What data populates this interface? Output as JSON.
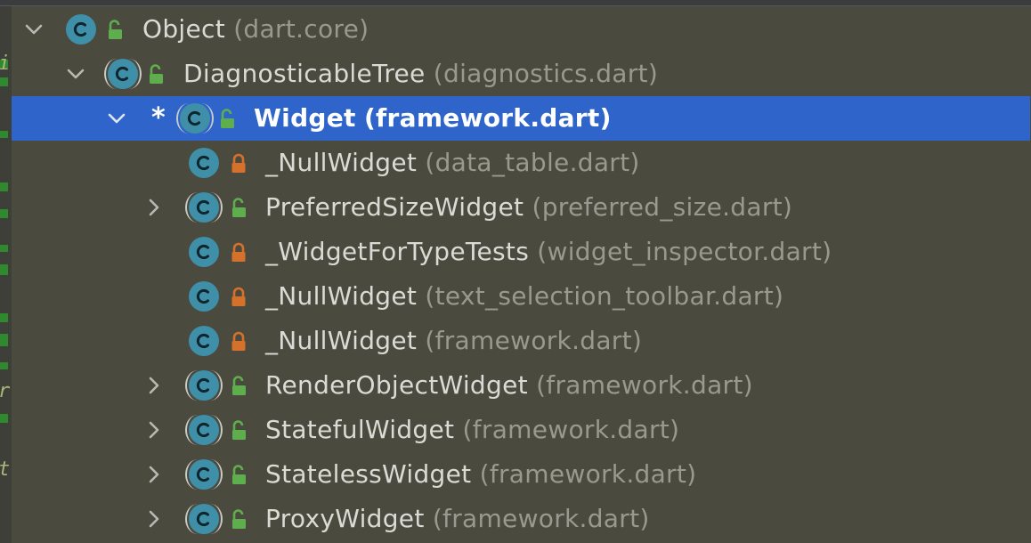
{
  "tree": {
    "rows": [
      {
        "name": "Object",
        "file": "(dart.core)"
      },
      {
        "name": "DiagnosticableTree",
        "file": "(diagnostics.dart)"
      },
      {
        "name": "Widget",
        "file": "(framework.dart)",
        "marker": "*"
      },
      {
        "name": "_NullWidget",
        "file": "(data_table.dart)"
      },
      {
        "name": "PreferredSizeWidget",
        "file": "(preferred_size.dart)"
      },
      {
        "name": "_WidgetForTypeTests",
        "file": "(widget_inspector.dart)"
      },
      {
        "name": "_NullWidget",
        "file": "(text_selection_toolbar.dart)"
      },
      {
        "name": "_NullWidget",
        "file": "(framework.dart)"
      },
      {
        "name": "RenderObjectWidget",
        "file": "(framework.dart)"
      },
      {
        "name": "StatefulWidget",
        "file": "(framework.dart)"
      },
      {
        "name": "StatelessWidget",
        "file": "(framework.dart)"
      },
      {
        "name": "ProxyWidget",
        "file": "(framework.dart)"
      }
    ],
    "class_icon_letter": "C"
  },
  "gutter": {
    "snippets": [
      "i",
      "r",
      "t"
    ]
  },
  "colors": {
    "background": "#4b4a3f",
    "selection": "#2f65ca",
    "class_icon": "#3f8fa8",
    "public_lock": "#5fae4e",
    "private_lock": "#d6712b",
    "name_text": "#d9dbd4",
    "file_text": "#999a8f"
  },
  "icons": {
    "expanded": "chevron-down-icon",
    "collapsed": "chevron-right-icon",
    "class": "class-c-icon",
    "abstract_class": "abstract-class-icon",
    "public": "unlocked-icon",
    "private": "locked-icon"
  }
}
